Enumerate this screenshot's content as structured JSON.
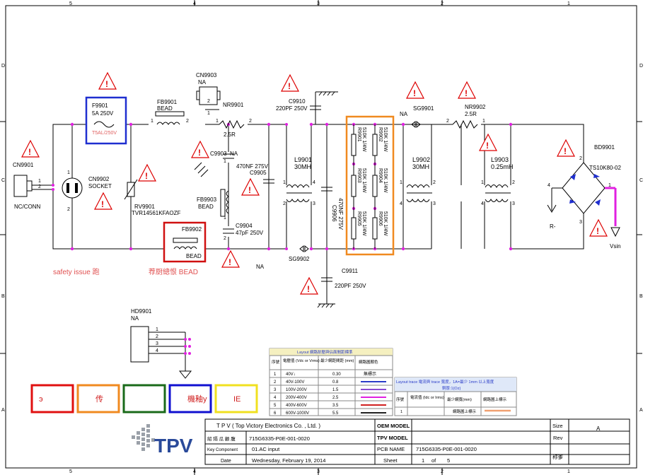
{
  "border": {
    "col_labels_top": [
      "5",
      "4",
      "3",
      "2",
      "1"
    ],
    "col_labels_bottom": [
      "5",
      "4",
      "3",
      "2",
      "1"
    ],
    "row_labels_left": [
      "D",
      "C",
      "B",
      "A"
    ],
    "row_labels_right": [
      "D",
      "C",
      "B",
      "A"
    ]
  },
  "parts": {
    "f9901": {
      "ref": "F9901",
      "val": "5A 250V",
      "mark": "T5AL/250V"
    },
    "fb9901": {
      "ref": "FB9901",
      "val": "BEAD"
    },
    "cn9903": {
      "ref": "CN9903",
      "val": "NA"
    },
    "nr9901": {
      "ref": "NR9901",
      "val": "2.5R"
    },
    "c9910": {
      "ref": "C9910",
      "val": "220PF 250V"
    },
    "c9903": {
      "ref": "C9903",
      "val": "NA"
    },
    "c9905": {
      "ref": "C9905",
      "val": "470NF 275V"
    },
    "fb9903": {
      "ref": "FB9903",
      "val": "BEAD"
    },
    "c9904": {
      "ref": "C9904",
      "val": "47pF 250V"
    },
    "fb9902": {
      "ref": "FB9902",
      "val": "BEAD"
    },
    "cn9901": {
      "ref": "CN9901",
      "val": "NC/CONN"
    },
    "cn9902": {
      "ref": "CN9902",
      "val": "SOCKET"
    },
    "rv9901": {
      "ref": "RV9901",
      "val": "TVR14561KFAOZF"
    },
    "l9901": {
      "ref": "L9901",
      "val": "30MH"
    },
    "c9906": {
      "ref": "C9906",
      "val": "470NF 275V"
    },
    "sg9902": {
      "ref": "SG9902",
      "val": "NA"
    },
    "c9911": {
      "ref": "C9911",
      "val": "220PF 250V"
    },
    "sg9901": {
      "ref": "SG9901",
      "val": "NA"
    },
    "nr9902": {
      "ref": "NR9902",
      "val": "2.5R"
    },
    "l9902": {
      "ref": "L9902",
      "val": "30MH"
    },
    "l9903": {
      "ref": "L9903",
      "val": "0.25mH"
    },
    "bd9901": {
      "ref": "BD9901",
      "val": "TS10K80-02"
    },
    "rminus": "R-",
    "vsin": "Vsin",
    "hd9901": {
      "ref": "HD9901",
      "val": "NA"
    },
    "res": [
      {
        "ref": "R9901",
        "val": "510K 1/4W"
      },
      {
        "ref": "R9902",
        "val": "510K 1/4W"
      },
      {
        "ref": "R9903",
        "val": "510K 1/4W"
      },
      {
        "ref": "R9904",
        "val": "510K 1/4W"
      },
      {
        "ref": "R9905",
        "val": "510K 1/4W"
      },
      {
        "ref": "R9906",
        "val": "510K 1/4W"
      }
    ],
    "na_labels": [
      "NA",
      "NA",
      "NA"
    ]
  },
  "notes": {
    "safety": "safety issue 跑",
    "bead_note": "荐厨總恨  BEAD"
  },
  "legend1": {
    "title": "Layout 網路耐壓與佔面間距標準",
    "headers": [
      "序號",
      "電壓值 (Vdc or Vrms)",
      "最少網距間距 (mm)",
      "網路圖顏色"
    ],
    "rows": [
      {
        "n": "1",
        "v": "40V↓",
        "d": "0.30",
        "c": "無標示",
        "color": ""
      },
      {
        "n": "2",
        "v": "40V-100V",
        "d": "0.8",
        "c": "",
        "color": "#2a3cc8"
      },
      {
        "n": "3",
        "v": "100V-200V",
        "d": "1.5",
        "c": "",
        "color": "#8a4ad0"
      },
      {
        "n": "4",
        "v": "200V-400V",
        "d": "2.5",
        "c": "",
        "color": "#e020e0"
      },
      {
        "n": "5",
        "v": "400V-600V",
        "d": "3.5",
        "c": "",
        "color": "#d02020"
      },
      {
        "n": "6",
        "v": "600V-1000V",
        "d": "5.5",
        "c": "",
        "color": "#222222"
      }
    ]
  },
  "legend2": {
    "title": "Layout trace 電流與 trace 寬度，1A=最少 1mm 以上寬度",
    "subtitle": "銅厚:1(Oz)",
    "headers": [
      "序號",
      "電流值 (Idc or Irms)",
      "最少網寬(mm)",
      "網路圖上標示"
    ],
    "row": {
      "n": "1",
      "i": "",
      "w": "",
      "c": "網路圖上標示"
    },
    "line_color": "#f0a070"
  },
  "color_boxes": [
    {
      "label": "э",
      "color": "#e01010"
    },
    {
      "label": "传",
      "color": "#f08a20"
    },
    {
      "label": "",
      "color": "#1a6a1a"
    },
    {
      "label": "機釉y",
      "color": "#1010d0"
    },
    {
      "label": "IE",
      "color": "#f0e020"
    }
  ],
  "title_block": {
    "company": "T P V  ( Top  Victory  Electronics  Co. , Ltd. )",
    "logo": "TPV",
    "row1_label": "紹 隔 瓜 顧 腹",
    "row1_value": "715G6335-P0E-001-0020",
    "row2_label": "Key Component",
    "row2_value": "01.AC input",
    "row3_label": "Date",
    "row3_value": "Wednesday, February 19, 2014",
    "oem_label": "OEM MODEL",
    "tpv_label": "TPV MODEL",
    "pcb_label": "PCB NAME",
    "pcb_value": "715G6335-P0E-001-0020",
    "sheet_label": "Sheet",
    "sheet_value": "1",
    "of_label": "of",
    "of_value": "5",
    "size_label": "Size",
    "size_value": "A",
    "rev_label": "Rev",
    "name_label": "称爹"
  }
}
